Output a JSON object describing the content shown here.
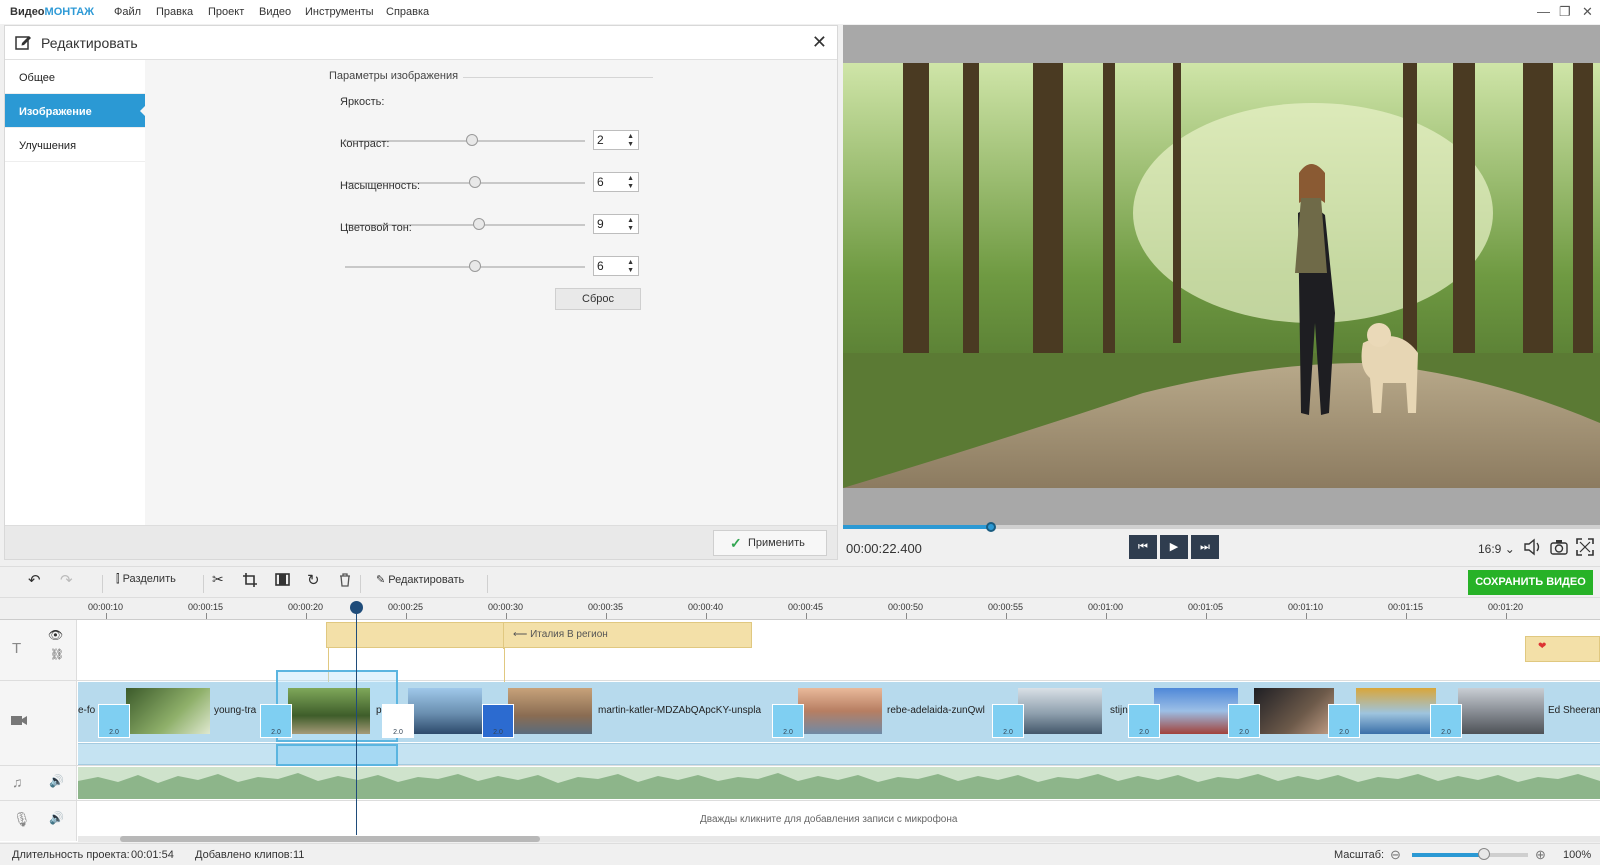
{
  "app": {
    "brand_prefix": "Видео",
    "brand_accent": "МОНТАЖ"
  },
  "menu": [
    "Файл",
    "Правка",
    "Проект",
    "Видео",
    "Инструменты",
    "Справка"
  ],
  "window_controls": [
    "—",
    "❐",
    "✕"
  ],
  "edit_panel": {
    "title": "Редактировать",
    "nav": [
      "Общее",
      "Изображение",
      "Улучшения"
    ],
    "active_nav": "Изображение",
    "section_title": "Параметры изображения",
    "params": [
      {
        "label": "Яркость:",
        "value": "2",
        "level": 0.53
      },
      {
        "label": "Контраст:",
        "value": "6",
        "level": 0.54
      },
      {
        "label": "Насыщенность:",
        "value": "9",
        "level": 0.56
      },
      {
        "label": "Цветовой тон:",
        "value": "6",
        "level": 0.54
      }
    ],
    "reset_label": "Сброс",
    "apply_label": "Применить"
  },
  "preview": {
    "time": "00:00:22.400",
    "progress": 0.195,
    "ratio": "16:9 ⌄"
  },
  "toolbar": {
    "split_label": "Разделить",
    "edit_label": "Редактировать",
    "save_label": "СОХРАНИТЬ ВИДЕО"
  },
  "ruler": [
    "00:00:10",
    "00:00:15",
    "00:00:20",
    "00:00:25",
    "00:00:30",
    "00:00:35",
    "00:00:40",
    "00:00:45",
    "00:00:50",
    "00:00:55",
    "00:01:00",
    "00:01:05",
    "00:01:10",
    "00:01:15",
    "00:01:20"
  ],
  "timeline": {
    "title_clip_text": "⟵ Италия  В регион",
    "clip_names": [
      "e-fo",
      "young-tra",
      "р",
      "martin-katler-MDZAbQApcKY-unspla",
      "rebe-adelaida-zunQwl",
      "stijn",
      "Ed Sheeran"
    ],
    "transition_value": "2.0",
    "mic_hint": "Дважды кликните для добавления записи с микрофона"
  },
  "status": {
    "duration_label": "Длительность проекта:",
    "duration_value": "00:01:54",
    "clips_label": "Добавлено клипов:",
    "clips_value": "11",
    "scale_label": "Масштаб:",
    "scale_value": "100%",
    "zoom_level": 0.62
  },
  "colors": {
    "accent": "#2b99d4",
    "save": "#27b227",
    "title_track": "#f3e0a8",
    "video_track": "#b7daed"
  }
}
